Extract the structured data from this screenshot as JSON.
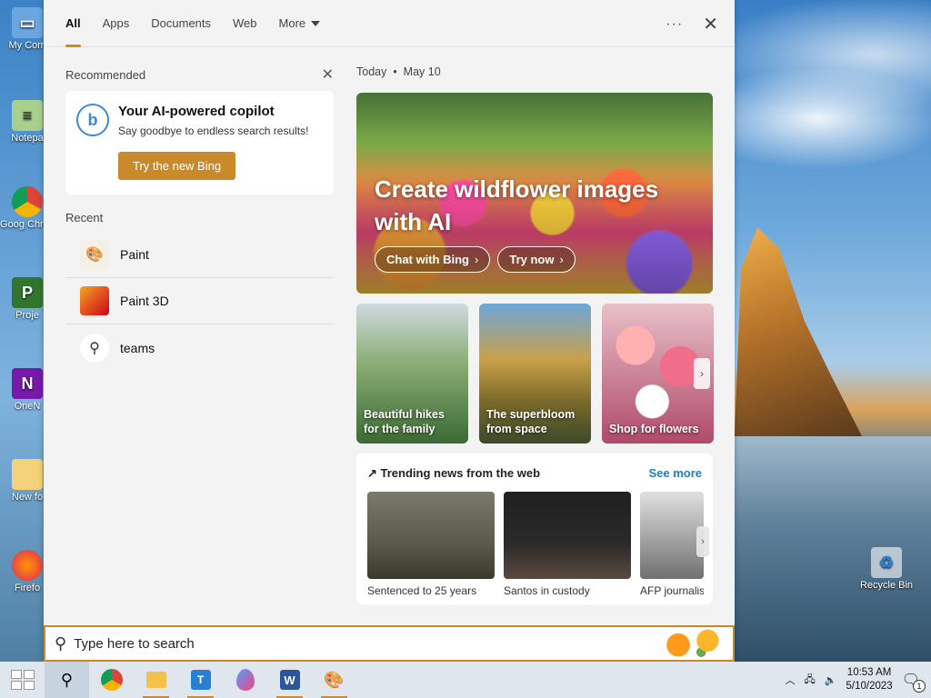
{
  "desktop": {
    "icons": [
      {
        "label": "My Com",
        "icon": "computer-icon"
      },
      {
        "label": "Notepa",
        "icon": "notepad-icon"
      },
      {
        "label": "Goog Chron",
        "icon": "chrome-icon"
      },
      {
        "label": "Proje",
        "icon": "project-icon"
      },
      {
        "label": "OneN",
        "icon": "onenote-icon"
      },
      {
        "label": "New fo",
        "icon": "folder-icon"
      },
      {
        "label": "Firefo",
        "icon": "firefox-icon"
      }
    ],
    "recycle_bin": {
      "label": "Recycle Bin",
      "icon": "recycle-bin-icon"
    }
  },
  "search_panel": {
    "tabs": [
      {
        "label": "All",
        "active": true
      },
      {
        "label": "Apps"
      },
      {
        "label": "Documents"
      },
      {
        "label": "Web"
      },
      {
        "label": "More"
      }
    ],
    "more_options": "···",
    "close": "✕",
    "recommended": {
      "title": "Recommended",
      "card_title": "Your AI-powered copilot",
      "card_subtitle": "Say goodbye to endless search results!",
      "button": "Try the new Bing",
      "logo_letter": "b"
    },
    "recent": {
      "title": "Recent",
      "items": [
        {
          "label": "Paint",
          "icon": "paint-icon"
        },
        {
          "label": "Paint 3D",
          "icon": "paint-3d-icon"
        },
        {
          "label": "teams",
          "icon": "search-icon"
        }
      ]
    },
    "today": {
      "label": "Today",
      "separator": "•",
      "date": "May 10"
    },
    "hero": {
      "title": "Create wildflower images with AI",
      "buttons": [
        "Chat with Bing",
        "Try now"
      ]
    },
    "tiles": [
      {
        "label": "Beautiful hikes for the family"
      },
      {
        "label": "The superbloom from space"
      },
      {
        "label": "Shop for flowers"
      }
    ],
    "trending": {
      "title": "Trending news from the web",
      "see_more": "See more",
      "items": [
        {
          "caption": "Sentenced to 25 years"
        },
        {
          "caption": "Santos in custody"
        },
        {
          "caption": "AFP journalist"
        }
      ]
    }
  },
  "searchbar": {
    "placeholder": "Type here to search"
  },
  "taskbar": {
    "apps": [
      "start-icon",
      "search-icon",
      "chrome-icon",
      "file-explorer-icon",
      "teams-icon",
      "paint-3d-icon",
      "word-icon",
      "paint-icon"
    ],
    "clock_time": "10:53 AM",
    "clock_date": "5/10/2023",
    "notification_count": "1"
  },
  "colors": {
    "accent": "#c88a2a",
    "link": "#1f7ec4"
  }
}
